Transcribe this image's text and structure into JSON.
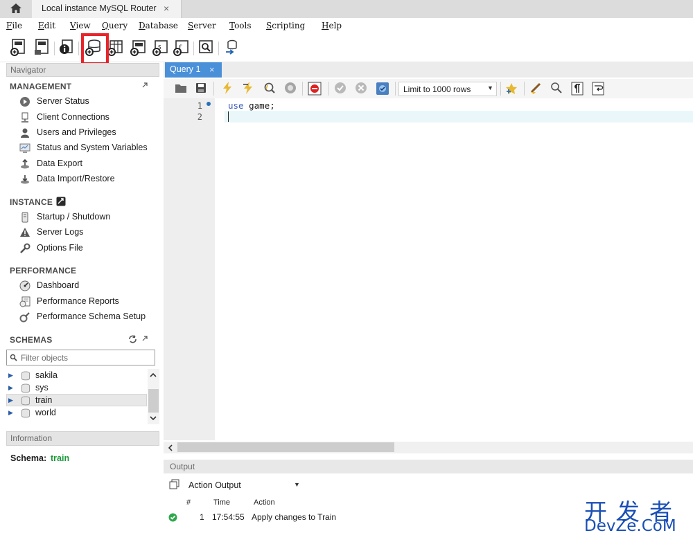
{
  "connection_tab": {
    "label": "Local instance MySQL Router",
    "close": "×"
  },
  "menu": [
    "File",
    "Edit",
    "View",
    "Query",
    "Database",
    "Server",
    "Tools",
    "Scripting",
    "Help"
  ],
  "navigator": {
    "header": "Navigator",
    "management": {
      "title": "MANAGEMENT",
      "items": [
        "Server Status",
        "Client Connections",
        "Users and Privileges",
        "Status and System Variables",
        "Data Export",
        "Data Import/Restore"
      ]
    },
    "instance": {
      "title": "INSTANCE",
      "items": [
        "Startup / Shutdown",
        "Server Logs",
        "Options File"
      ]
    },
    "performance": {
      "title": "PERFORMANCE",
      "items": [
        "Dashboard",
        "Performance Reports",
        "Performance Schema Setup"
      ]
    },
    "schemas": {
      "title": "SCHEMAS",
      "filter_placeholder": "Filter objects",
      "items": [
        "sakila",
        "sys",
        "train",
        "world"
      ],
      "selected": "train"
    }
  },
  "information": {
    "header": "Information",
    "schema_key": "Schema:",
    "schema_value": "train"
  },
  "editor": {
    "tab_label": "Query 1",
    "tab_close": "×",
    "limit_label": "Limit to 1000 rows",
    "line_numbers": [
      "1",
      "2"
    ],
    "code": {
      "keyword": "use",
      "rest": " game;"
    }
  },
  "output": {
    "header": "Output",
    "selector": "Action Output",
    "columns": [
      "#",
      "Time",
      "Action"
    ],
    "rows": [
      {
        "num": "1",
        "time": "17:54:55",
        "action": "Apply changes to Train"
      }
    ]
  },
  "watermark": {
    "cn": "开发者",
    "en": "DevZe.CoM"
  },
  "colors": {
    "accent_tab": "#4a90d9",
    "highlight_box": "#e8242a",
    "schema_value": "#1a9a3a",
    "keyword": "#3b5bbf",
    "watermark": "#1a4fb5"
  }
}
